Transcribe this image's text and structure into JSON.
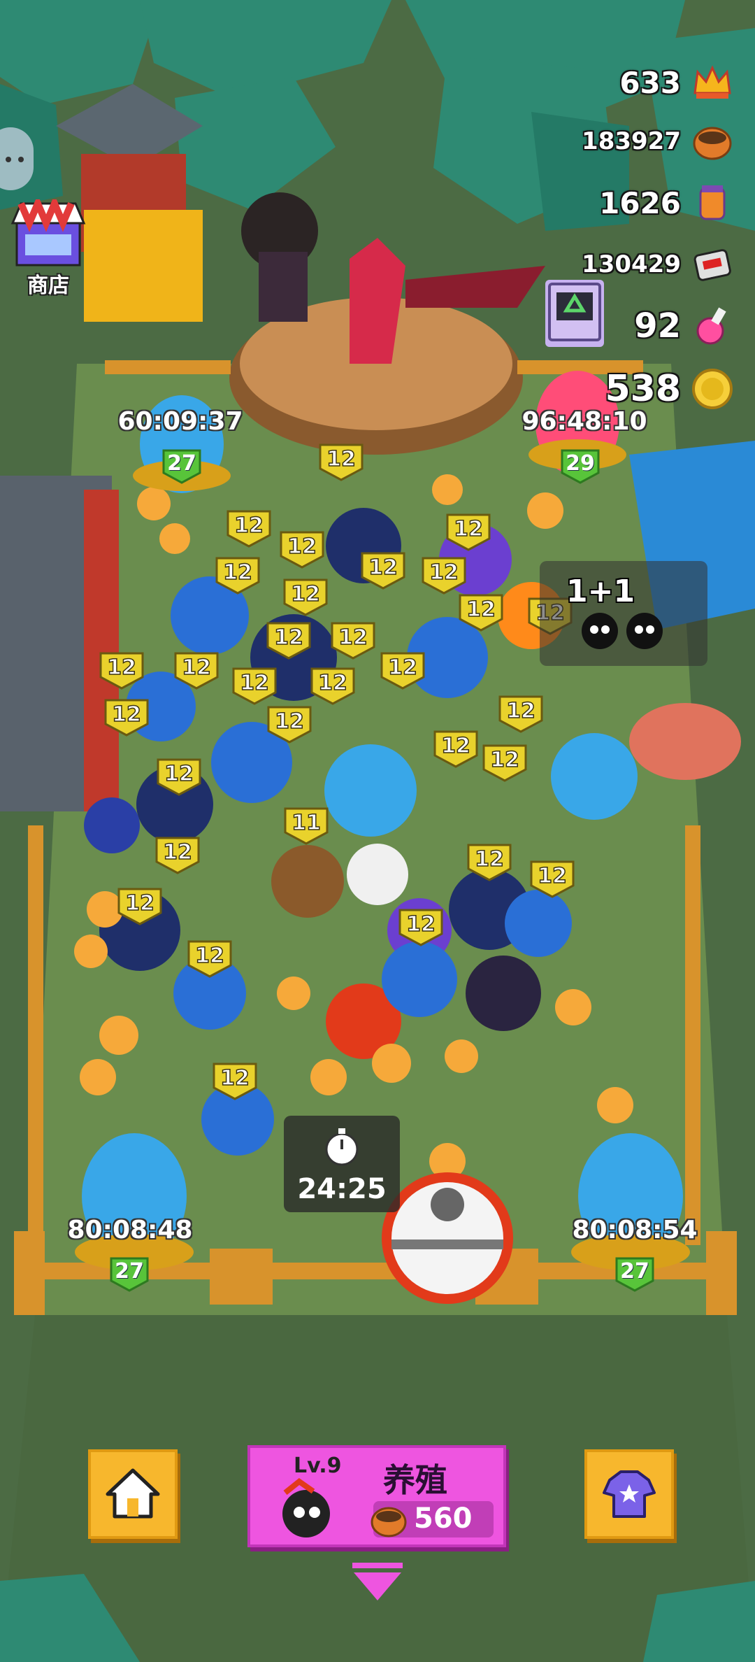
{
  "hud": {
    "resources": [
      {
        "id": "crown",
        "value": "633",
        "icon": "crown-icon"
      },
      {
        "id": "food-bowl",
        "value": "183927",
        "icon": "food-bowl-icon"
      },
      {
        "id": "jar",
        "value": "1626",
        "icon": "jar-icon"
      },
      {
        "id": "tickets",
        "value": "130429",
        "icon": "ticket-icon"
      },
      {
        "id": "potion",
        "value": "92",
        "icon": "potion-icon"
      },
      {
        "id": "coin",
        "value": "538",
        "icon": "coin-icon"
      }
    ],
    "shop_label": "商店"
  },
  "eggs": [
    {
      "timer": "60:09:37",
      "level": "27",
      "color": "#39a7e8"
    },
    {
      "timer": "96:48:10",
      "level": "29",
      "color": "#ff4d78"
    },
    {
      "timer": "80:08:48",
      "level": "27",
      "color": "#39a7e8"
    },
    {
      "timer": "80:08:54",
      "level": "27",
      "color": "#39a7e8"
    }
  ],
  "creature_level_tags": [
    "12",
    "11"
  ],
  "merge_popup": {
    "text": "1+1"
  },
  "stopwatch": {
    "time": "24:25"
  },
  "bottom_bar": {
    "breed_level": "Lv.9",
    "breed_title": "养殖",
    "breed_cost": "560"
  },
  "colors": {
    "grass": "#5a7a45",
    "fence": "#d8932c",
    "accent_pink": "#ee55e0",
    "button_orange": "#f7b72d",
    "level_tag": "#e9d22c"
  }
}
